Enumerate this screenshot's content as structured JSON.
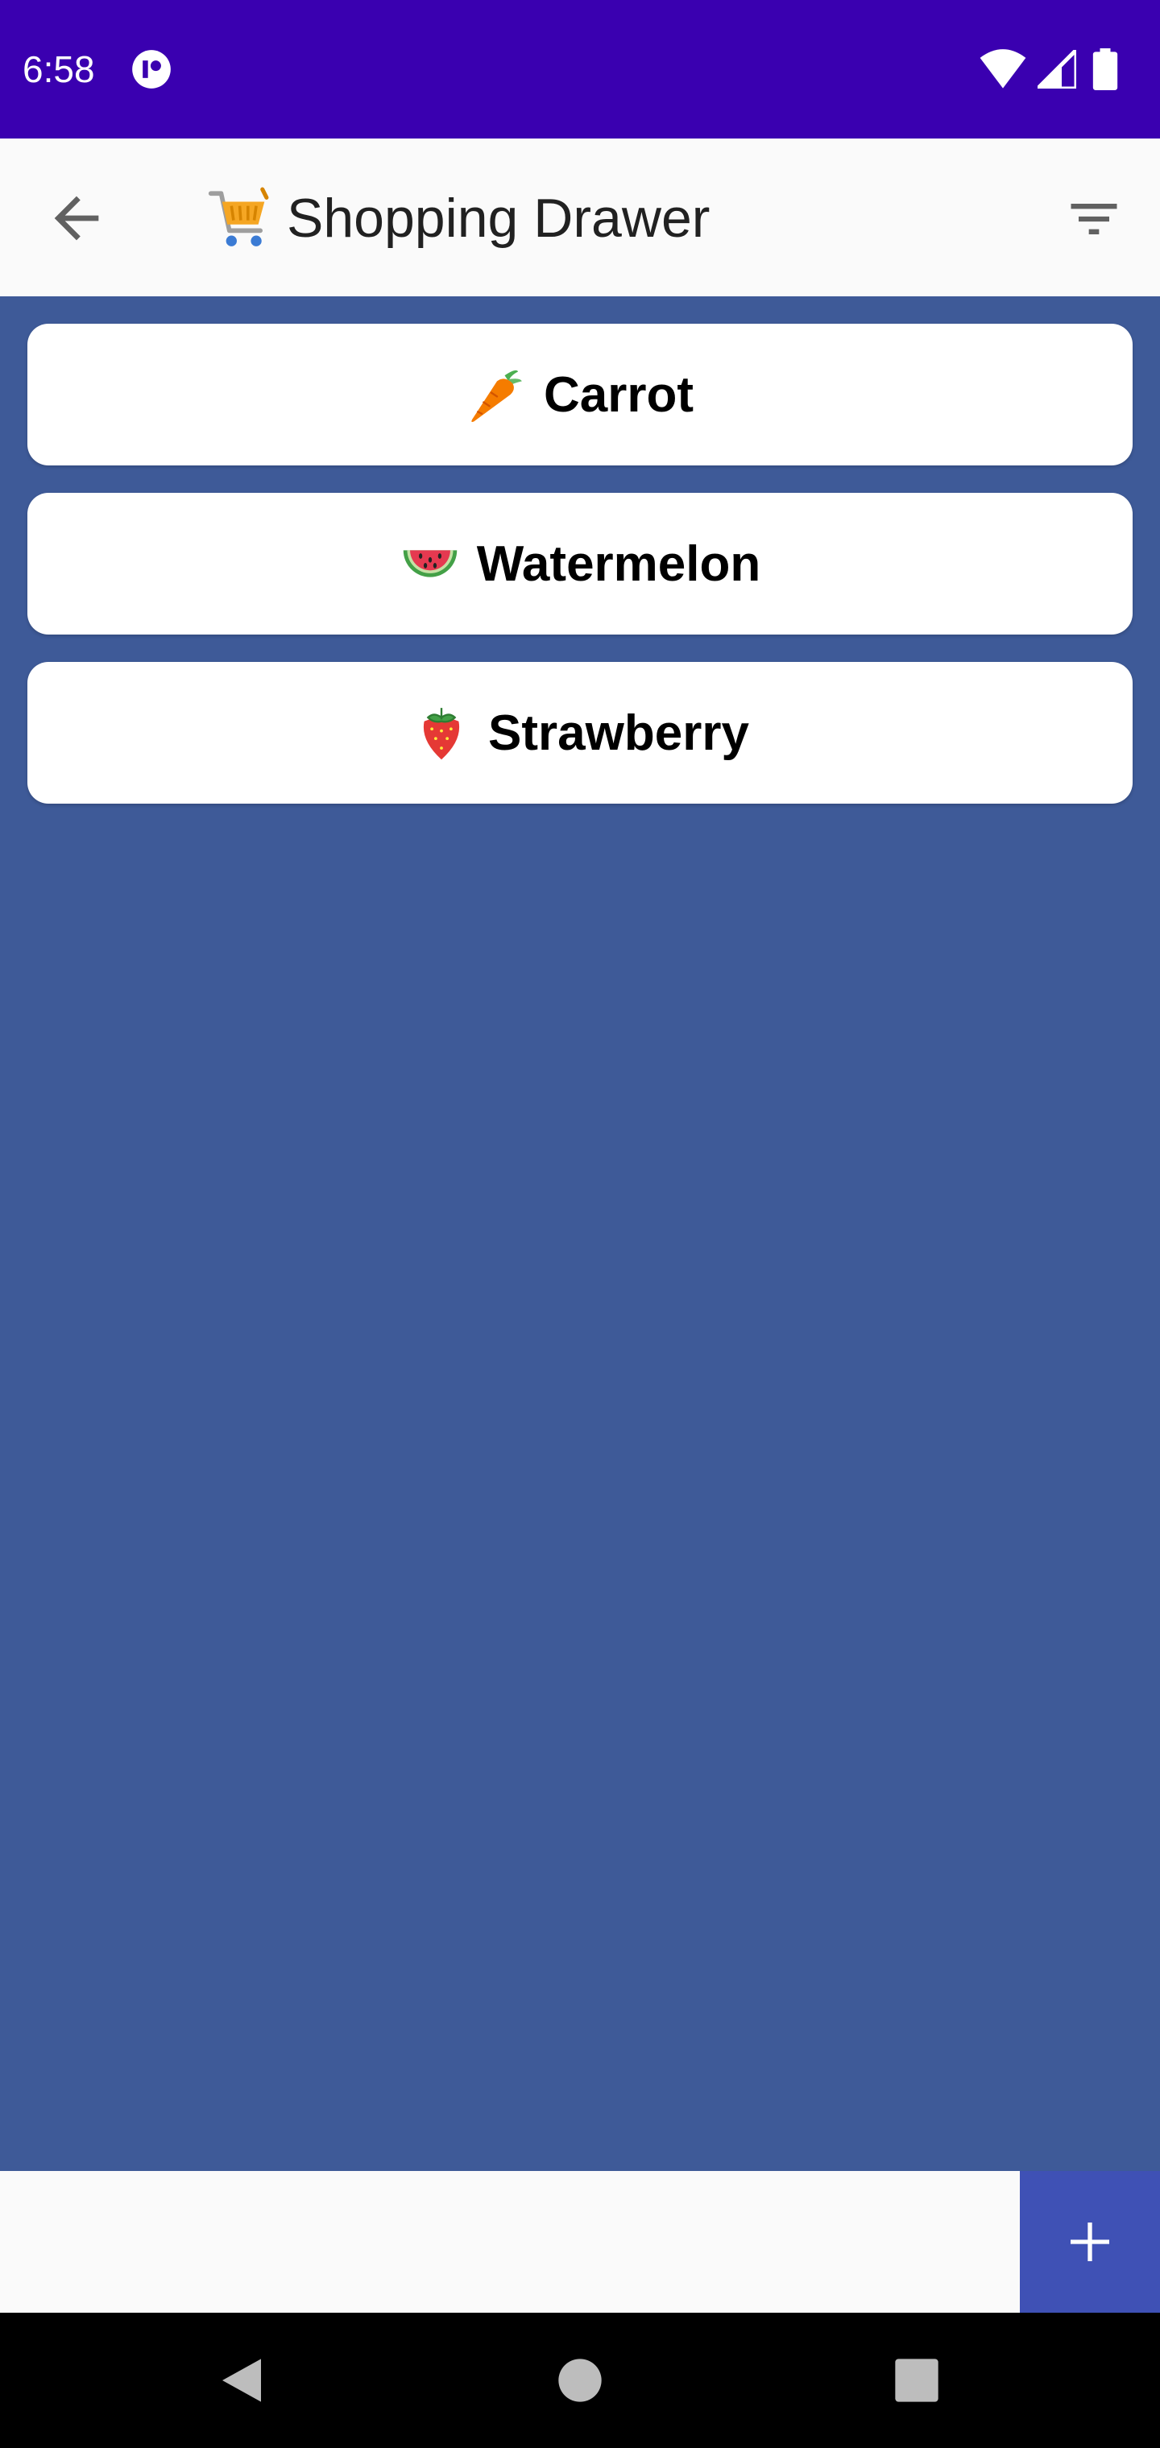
{
  "status_bar": {
    "time": "6:58",
    "icons": [
      "app-notification-icon",
      "wifi-icon",
      "signal-icon",
      "battery-icon"
    ],
    "background": "#3a00b0"
  },
  "app_bar": {
    "title": "Shopping Drawer",
    "title_icon": "shopping-cart-icon",
    "back_icon": "arrow-left-icon",
    "action_icon": "filter-icon"
  },
  "items": [
    {
      "label": "Carrot",
      "icon": "carrot-icon"
    },
    {
      "label": "Watermelon",
      "icon": "watermelon-icon"
    },
    {
      "label": "Strawberry",
      "icon": "strawberry-icon"
    }
  ],
  "input": {
    "value": "",
    "placeholder": ""
  },
  "add_button": {
    "icon": "plus-icon",
    "color": "#3f51b5"
  },
  "colors": {
    "list_background": "#3e5a98",
    "app_bar": "#fafafa",
    "nav_bar": "#000000"
  }
}
